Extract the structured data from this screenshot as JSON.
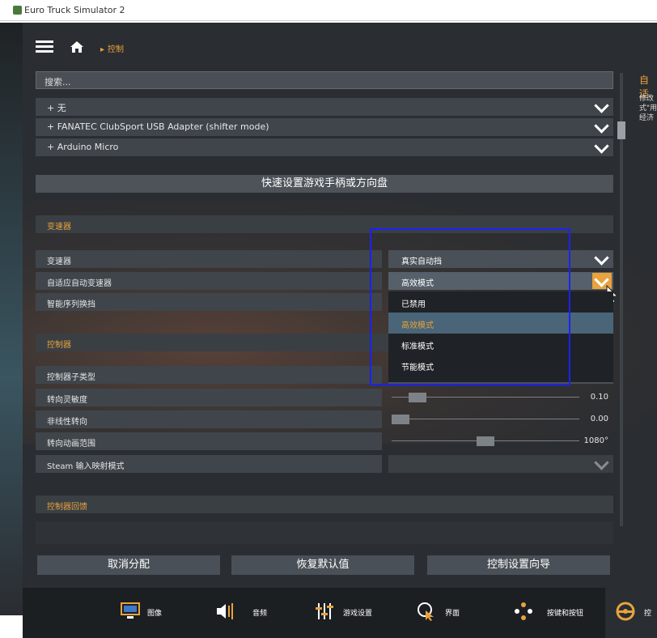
{
  "window": {
    "title": "Euro Truck Simulator 2"
  },
  "header": {
    "breadcrumb": "控制"
  },
  "search": {
    "placeholder": "搜索..."
  },
  "devices": [
    {
      "label": "+ 无"
    },
    {
      "label": "+ FANATEC ClubSport USB Adapter (shifter mode)"
    },
    {
      "label": "+ Arduino Micro"
    }
  ],
  "quick_setup_label": "快速设置游戏手柄或方向盘",
  "sections": {
    "transmission": "变速器",
    "controller": "控制器",
    "feedback": "控制器回馈"
  },
  "transmission_rows": [
    {
      "label": "变速器",
      "value": "真实自动挡"
    },
    {
      "label": "自适应自动变速器",
      "value": "高效模式"
    },
    {
      "label": "智能序列换挡",
      "value": ""
    }
  ],
  "dropdown": {
    "options": [
      "已禁用",
      "高效模式",
      "标准模式",
      "节能模式"
    ],
    "selected": "高效模式"
  },
  "controller_rows": [
    {
      "label": "控制器子类型",
      "value": ""
    },
    {
      "label": "转向灵敏度",
      "value": "0.10",
      "fraction": 0.1
    },
    {
      "label": "非线性转向",
      "value": "0.00",
      "fraction": 0.0
    },
    {
      "label": "转向动画范围",
      "value": "1080°",
      "fraction": 0.5
    },
    {
      "label": "Steam 输入映射模式",
      "value": ""
    }
  ],
  "footer_buttons": [
    "取消分配",
    "恢复默认值",
    "控制设置向导"
  ],
  "right_panel": {
    "title": "自适",
    "text": "修改 式\"用 经济"
  },
  "tabs": [
    {
      "label": "图像",
      "icon": "monitor-icon"
    },
    {
      "label": "音频",
      "icon": "speaker-icon"
    },
    {
      "label": "游戏设置",
      "icon": "sliders-icon"
    },
    {
      "label": "界面",
      "icon": "cursor-icon"
    },
    {
      "label": "按键和按钮",
      "icon": "gamepad-buttons-icon"
    },
    {
      "label": "控",
      "icon": "steering-wheel-icon"
    }
  ],
  "colors": {
    "accent": "#e8a33d",
    "highlight": "#1a22ff",
    "selected_bg": "#4a6577"
  }
}
